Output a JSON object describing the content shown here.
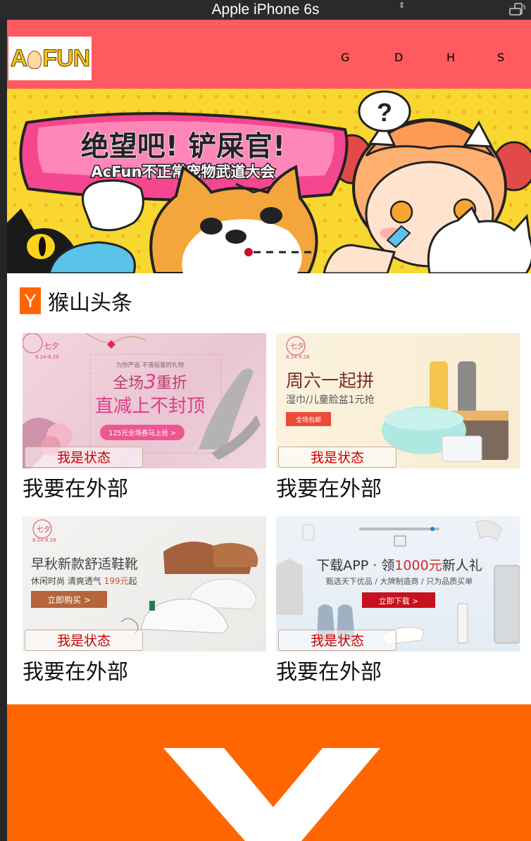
{
  "simulator": {
    "device_title": "Apple iPhone 6s",
    "chevron_glyph": "⇕"
  },
  "header": {
    "logo_text_a": "A",
    "logo_text_fun": "FUN",
    "nav": [
      {
        "label": "G"
      },
      {
        "label": "D"
      },
      {
        "label": "H"
      },
      {
        "label": "S"
      }
    ],
    "bg_color": "#ff5a5f"
  },
  "banner": {
    "headline": "绝望吧! 铲屎官!",
    "subline": "AcFun不正常宠物武道大会",
    "question_mark": "?"
  },
  "section": {
    "badge": "Y",
    "title": "猴山头条",
    "badge_color": "#ff6600"
  },
  "cards": [
    {
      "tag_top": "七夕",
      "tag_date": "8.24-8.28",
      "small_line": "为你严选 不落俗套的礼物",
      "line1a": "全场",
      "line1num": "3",
      "line1b": "重折",
      "line2": "直减上不封顶",
      "pill": "125元全场券马上抢 >",
      "status": "我是状态",
      "caption": "我要在外部"
    },
    {
      "tag_top": "七夕",
      "tag_date": "8.24-8.28",
      "line1": "周六一起拼",
      "line2": "湿巾/儿童脸盆1元抢",
      "pill": "全场包邮",
      "status": "我是状态",
      "caption": "我要在外部"
    },
    {
      "tag_top": "七夕",
      "tag_date": "8.24-8.28",
      "line1": "早秋新款舒适鞋靴",
      "line2a": "休闲时尚 清爽透气 ",
      "line2price": "199元",
      "line2b": "起",
      "pill": "立即购买 >",
      "status": "我是状态",
      "caption": "我要在外部"
    },
    {
      "line1a": "下载APP · 领",
      "line1num": "1000元",
      "line1b": "新人礼",
      "line2": "甄选天下优品 / 大牌制造商 / 只为品质买单",
      "pill": "立即下载 >",
      "status": "我是状态",
      "caption": "我要在外部"
    }
  ],
  "footer": {
    "logo_color": "#ff6600"
  }
}
